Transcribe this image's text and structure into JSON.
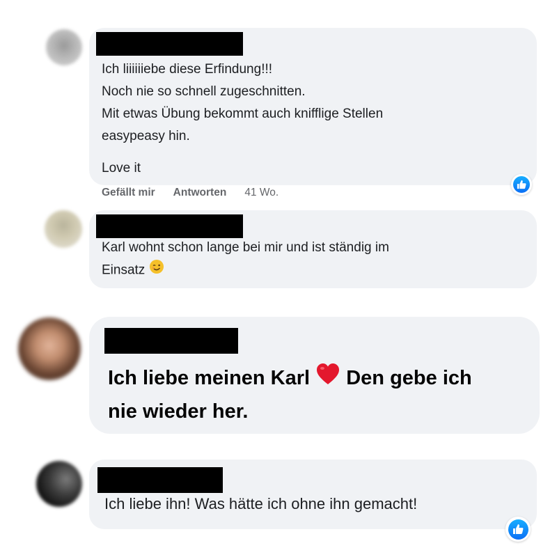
{
  "comments": [
    {
      "lines": [
        "Ich liiiiiiebe diese Erfindung!!!",
        "Noch nie so schnell zugeschnitten.",
        "Mit etwas Übung bekommt auch knifflige Stellen",
        "easypeasy hin."
      ],
      "extra_line": "Love it",
      "actions": {
        "like": "Gefällt mir",
        "reply": "Antworten",
        "time": "41 Wo."
      },
      "reaction_icon": "thumbs-up-icon"
    },
    {
      "lines": [
        "Karl wohnt schon lange bei mir und ist ständig im",
        "Einsatz"
      ],
      "emoji": "wink-emoji-icon"
    },
    {
      "part1": "Ich liebe meinen Karl",
      "part2": "Den gebe ich",
      "line2": "nie wieder her.",
      "emoji": "red-heart-icon"
    },
    {
      "lines": [
        "Ich liebe ihn! Was hätte ich ohne ihn gemacht!"
      ],
      "reaction_icon": "thumbs-up-icon"
    }
  ],
  "colors": {
    "bubble": "#f0f2f5",
    "redaction": "#000000",
    "like_blue": "#0b6ff5",
    "meta_gray": "#65676b"
  }
}
